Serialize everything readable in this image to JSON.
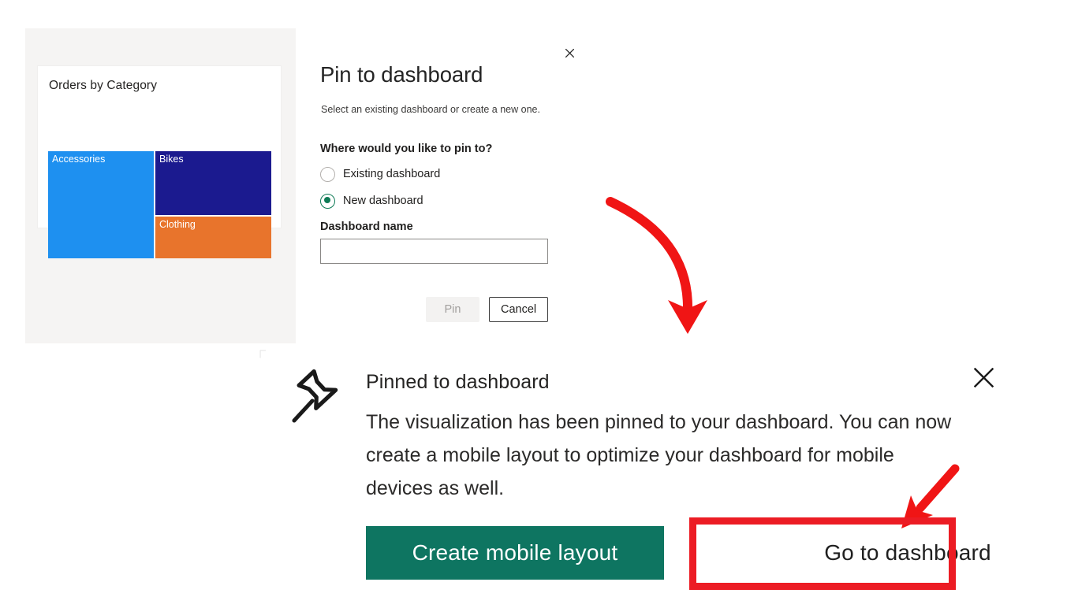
{
  "report": {
    "visual_title": "Orders by Category",
    "treemap": {
      "tiles": [
        {
          "label": "Accessories",
          "color": "#1e90f0"
        },
        {
          "label": "Bikes",
          "color": "#1b1a8f"
        },
        {
          "label": "Clothing",
          "color": "#e8742c"
        }
      ]
    }
  },
  "dialog": {
    "title": "Pin to dashboard",
    "subtitle": "Select an existing dashboard or create a new one.",
    "question": "Where would you like to pin to?",
    "options": [
      {
        "label": "Existing dashboard",
        "selected": false
      },
      {
        "label": "New dashboard",
        "selected": true
      }
    ],
    "field_label": "Dashboard name",
    "field_value": "",
    "field_placeholder": "",
    "primary_button": "Pin",
    "secondary_button": "Cancel",
    "close_icon": "close-icon"
  },
  "toast": {
    "icon": "pushpin-icon",
    "title": "Pinned to dashboard",
    "body": "The visualization has been pinned to your dashboard. You can now create a mobile layout to optimize your dashboard for mobile devices as well.",
    "primary_button": "Create mobile layout",
    "secondary_button": "Go to dashboard",
    "close_icon": "close-icon"
  },
  "annotations": {
    "highlight_color": "#ec1c24",
    "arrow_color": "#f01515"
  },
  "colors": {
    "accent_green": "#0e7561",
    "radio_green": "#0f7b56",
    "panel_bg": "#f5f4f3",
    "annotation_red": "#ec1c24"
  }
}
